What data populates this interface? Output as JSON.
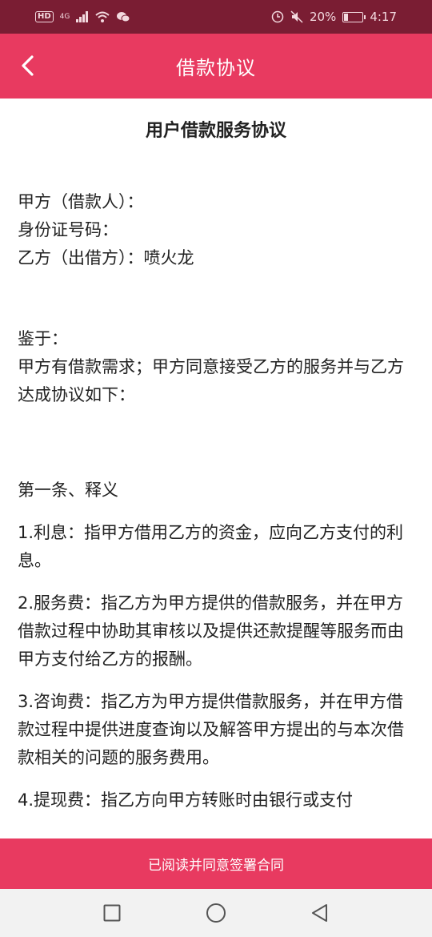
{
  "status": {
    "network": "4G",
    "battery_text": "20%",
    "battery_level": 0.2,
    "time": "4:17"
  },
  "header": {
    "title": "借款协议"
  },
  "document": {
    "title": "用户借款服务协议",
    "party_a": "甲方（借款人）：",
    "id_number": "身份证号码：",
    "party_b": "乙方（出借方）：喷火龙",
    "whereas": "鉴于：",
    "whereas_text": "甲方有借款需求；甲方同意接受乙方的服务并与乙方达成协议如下：",
    "article1_title": "第一条、释义",
    "clause1": "1.利息：指甲方借用乙方的资金，应向乙方支付的利息。",
    "clause2": "2.服务费：指乙方为甲方提供的借款服务，并在甲方借款过程中协助其审核以及提供还款提醒等服务而由甲方支付给乙方的报酬。",
    "clause3": "3.咨询费：指乙方为甲方提供借款服务，并在甲方借款过程中提供进度查询以及解答甲方提出的与本次借款相关的问题的服务费用。",
    "clause4": "4.提现费：指乙方向甲方转账时由银行或支付"
  },
  "footer": {
    "agree_label": "已阅读并同意签署合同"
  },
  "icons": {
    "back": "chevron-left-icon",
    "recent": "square-icon",
    "home": "circle-icon",
    "back_system": "triangle-back-icon"
  }
}
